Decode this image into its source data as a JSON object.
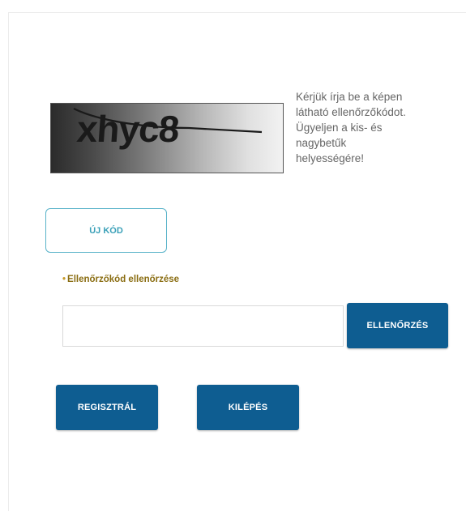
{
  "captcha": {
    "code_text": "xhyc8",
    "instructions": [
      "Kérjük írja be a képen",
      "látható ellenőrzőkódot.",
      "Ügyeljen a kis- és",
      "nagybetűk",
      "helyességére!"
    ]
  },
  "buttons": {
    "new_code_label": "ÚJ KÓD",
    "verify_label": "ELLENŐRZÉS",
    "register_label": "REGISZTRÁL",
    "exit_label": "KILÉPÉS"
  },
  "verify_field": {
    "label_marker": "•",
    "label": "Ellenőrzőkód ellenőrzése",
    "value": "",
    "placeholder": ""
  },
  "colors": {
    "primary_button": "#0e5d91",
    "secondary_border": "#59b3c9",
    "label_text": "#8a6d12"
  }
}
